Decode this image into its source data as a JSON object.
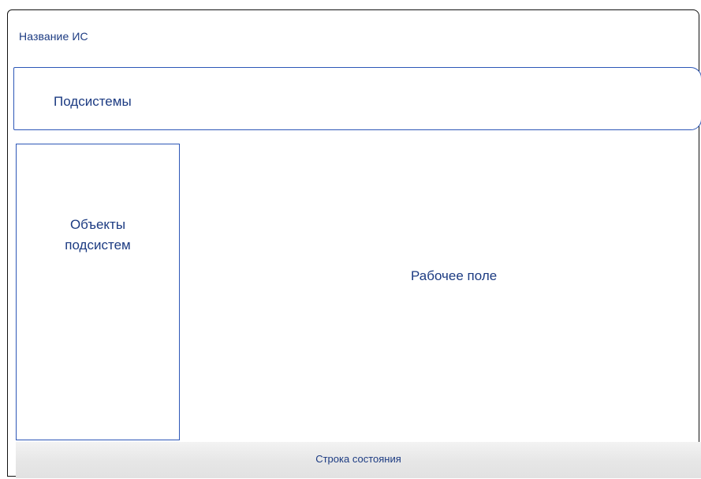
{
  "app": {
    "title": "Название ИС"
  },
  "subsystems": {
    "label": "Подсистемы"
  },
  "objects_panel": {
    "label": "Объекты\nподсистем"
  },
  "workspace": {
    "label": "Рабочее поле"
  },
  "status_bar": {
    "label": "Строка состояния"
  },
  "colors": {
    "frame": "#111111",
    "outline": "#2d57b7",
    "text": "#1c3b82",
    "status_bar_bg": "#e6e6e6"
  }
}
